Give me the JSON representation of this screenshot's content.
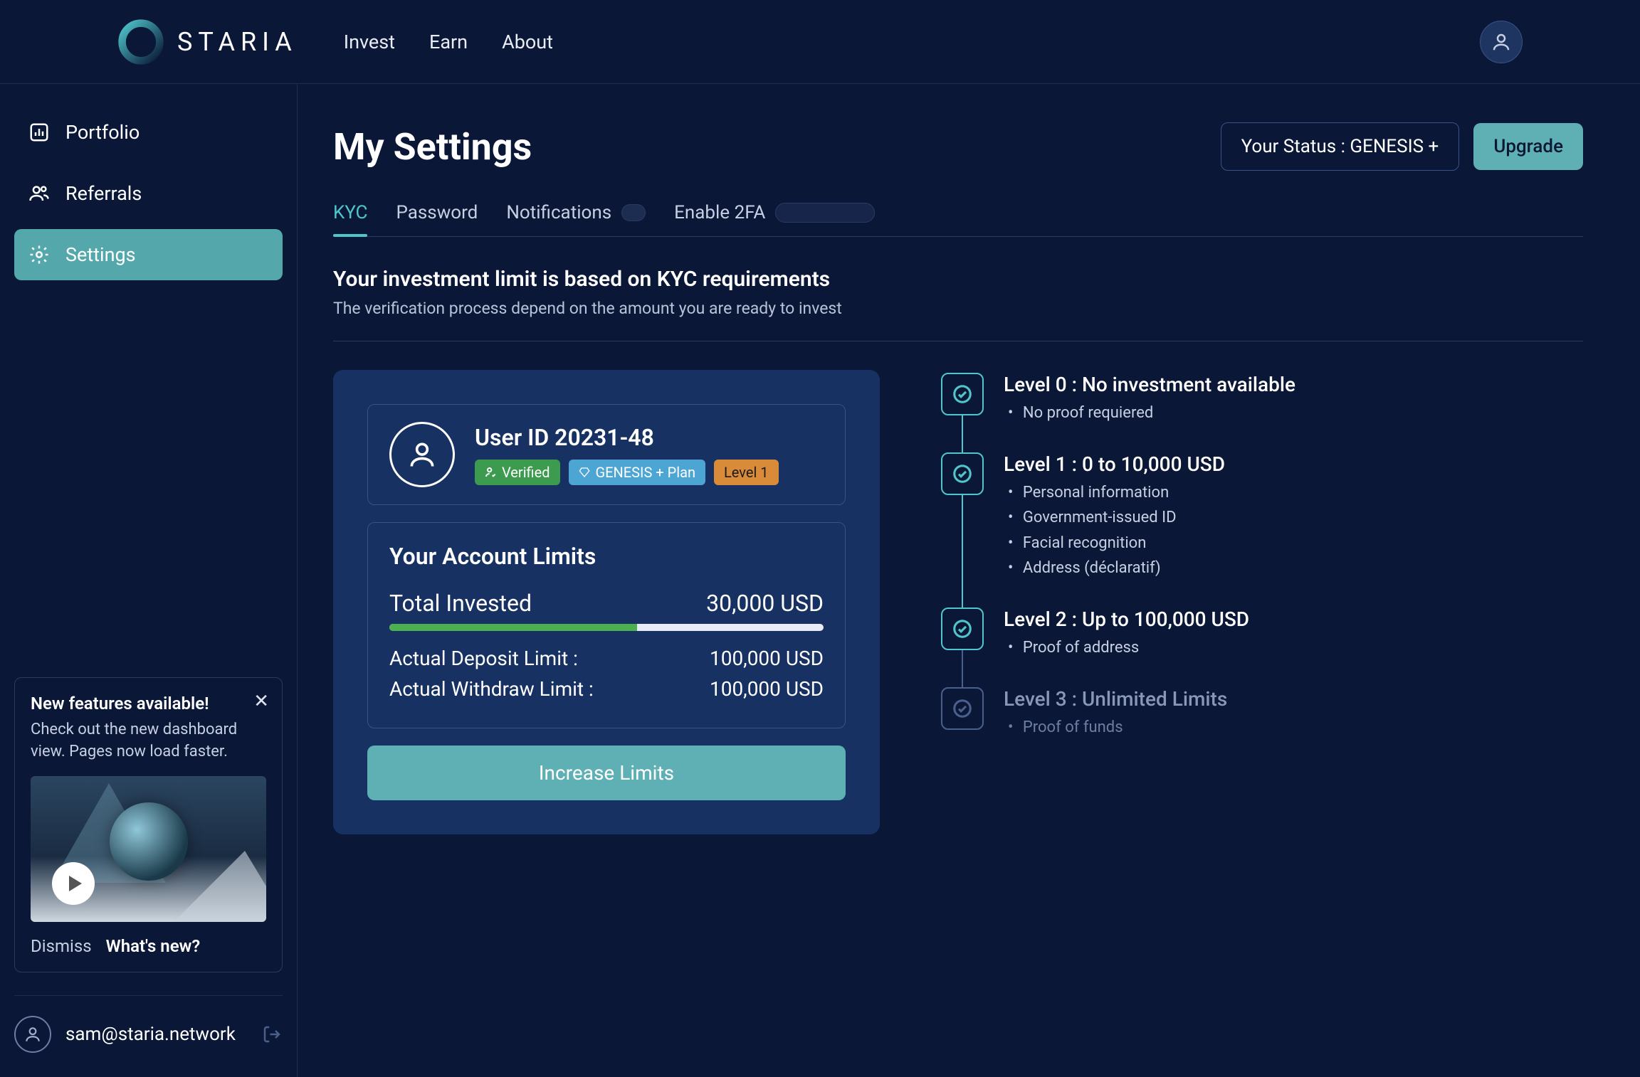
{
  "brand": "STARIA",
  "nav": {
    "invest": "Invest",
    "earn": "Earn",
    "about": "About"
  },
  "sidebar": {
    "items": [
      {
        "label": "Portfolio"
      },
      {
        "label": "Referrals"
      },
      {
        "label": "Settings"
      }
    ]
  },
  "features_card": {
    "title": "New features available!",
    "desc": "Check out the new dashboard view. Pages now load faster.",
    "dismiss": "Dismiss",
    "whatsnew": "What's new?"
  },
  "footer": {
    "email": "sam@staria.network"
  },
  "page": {
    "title": "My Settings",
    "status": "Your Status : GENESIS +",
    "upgrade": "Upgrade"
  },
  "tabs": {
    "kyc": "KYC",
    "password": "Password",
    "notifications": "Notifications",
    "enable2fa": "Enable 2FA"
  },
  "kyc": {
    "heading": "Your investment limit is based on KYC requirements",
    "sub": "The verification process depend on the amount you are ready to invest",
    "user_id": "User ID 20231-48",
    "verified": "Verified",
    "plan": "GENESIS + Plan",
    "level": "Level 1",
    "limits_title": "Your Account Limits",
    "total_label": "Total Invested",
    "total_value": "30,000 USD",
    "bar_pct": 57,
    "deposit_label": "Actual Deposit Limit :",
    "deposit_value": "100,000 USD",
    "withdraw_label": "Actual Withdraw Limit :",
    "withdraw_value": "100,000 USD",
    "increase": "Increase Limits"
  },
  "levels": [
    {
      "title": "Level 0 : No investment available",
      "items": [
        "No proof requiered"
      ],
      "dim": false,
      "linedim": false
    },
    {
      "title": "Level 1 : 0 to 10,000 USD",
      "items": [
        "Personal information",
        "Government-issued ID",
        "Facial recognition",
        "Address (déclaratif)"
      ],
      "dim": false,
      "linedim": false
    },
    {
      "title": "Level 2 : Up to 100,000 USD",
      "items": [
        "Proof of address"
      ],
      "dim": false,
      "linedim": true
    },
    {
      "title": "Level 3 : Unlimited Limits",
      "items": [
        "Proof of funds"
      ],
      "dim": true,
      "linedim": false
    }
  ]
}
